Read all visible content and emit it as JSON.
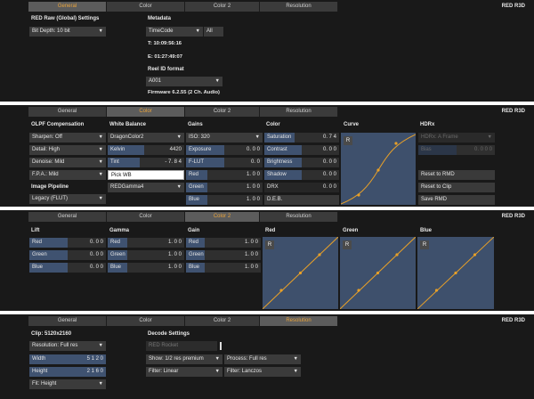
{
  "brand": "RED R3D",
  "tabs": [
    "General",
    "Color",
    "Color 2",
    "Resolution"
  ],
  "general": {
    "raw_header": "RED Raw (Global) Settings",
    "bit_depth": "Bit Depth: 10 bit",
    "metadata_header": "Metadata",
    "timecode_select": "TimeCode",
    "all_button": "All",
    "tc_start": "T: 10:09:56:16",
    "tc_end": "E: 01:27:49:07",
    "reel_header": "Reel ID format",
    "reel_select": "A001",
    "firmware": "Firmware 6.2.55 (2 Ch. Audio)"
  },
  "color": {
    "olpf_header": "OLPF Compensation",
    "sharpen": "Sharpen: Off",
    "detail": "Detail: High",
    "denoise": "Denoise: Mild",
    "fpa": "F.P.A.: Mild",
    "pipeline_header": "Image Pipeline",
    "pipeline": "Legacy (FLUT)",
    "wb_header": "White Balance",
    "wb_select": "DragonColor2",
    "kelvin_label": "Kelvin",
    "kelvin_value": "4420",
    "tint_label": "Tint",
    "tint_value": "- 7. 8 4",
    "pick_wb": "Pick WB",
    "gamma_select": "REDGamma4",
    "gains_header": "Gains",
    "iso": "ISO: 320",
    "exposure_label": "Exposure",
    "exposure_value": "0. 0 0",
    "flut_label": "F-LUT",
    "flut_value": "0. 0",
    "red_label": "Red",
    "red_value": "1. 0 0",
    "green_label": "Green",
    "green_value": "1. 0 0",
    "blue_label": "Blue",
    "blue_value": "1. 0 0",
    "color_header": "Color",
    "saturation_label": "Saturation",
    "saturation_value": "0. 7 4",
    "contrast_label": "Contrast",
    "contrast_value": "0. 0 0",
    "brightness_label": "Brightness",
    "brightness_value": "0. 0 0",
    "shadow_label": "Shadow",
    "shadow_value": "0. 0 0",
    "drx_label": "DRX",
    "drx_value": "0. 0 0",
    "deb_label": "D.E.B.",
    "curve_header": "Curve",
    "r_button": "R",
    "hdrx_header": "HDRx",
    "hdrx_select": "HDRx: A Frame",
    "bias_label": "Bias",
    "bias_value": "0. 0 0 0",
    "reset_rmd": "Reset to RMD",
    "reset_clip": "Reset to Clip",
    "save_rmd": "Save RMD"
  },
  "color2": {
    "lift_header": "Lift",
    "gamma_header": "Gamma",
    "gain_header": "Gain",
    "red_label": "Red",
    "green_label": "Green",
    "blue_label": "Blue",
    "lift_red": "0. 0 0",
    "lift_green": "0. 0 0",
    "lift_blue": "0. 0 0",
    "gamma_red": "1. 0 0",
    "gamma_green": "1. 0 0",
    "gamma_blue": "1. 0 0",
    "gain_red": "1. 0 0",
    "gain_green": "1. 0 0",
    "gain_blue": "1. 0 0",
    "curve_red_header": "Red",
    "curve_green_header": "Green",
    "curve_blue_header": "Blue",
    "r_button": "R"
  },
  "resolution": {
    "clip_header": "Clip: 5120x2160",
    "resolution_select": "Resolution: Full res",
    "width_label": "Width",
    "width_value": "5 1 2 0",
    "height_label": "Height",
    "height_value": "2 1 6 0",
    "fit_select": "Fit: Height",
    "decode_header": "Decode Settings",
    "red_rocket": "RED Rocket",
    "show_select": "Show: 1/2 res premium",
    "process_select": "Process: Full res",
    "filter1_select": "Filter: Linear",
    "filter2_select": "Filter: Lanczos"
  },
  "colors": {
    "accent": "#e8a33c",
    "slider_fill": "#3f5270",
    "curve_bg": "#3e506c",
    "curve_line": "#e8a028",
    "panel_bg": "#191919"
  }
}
